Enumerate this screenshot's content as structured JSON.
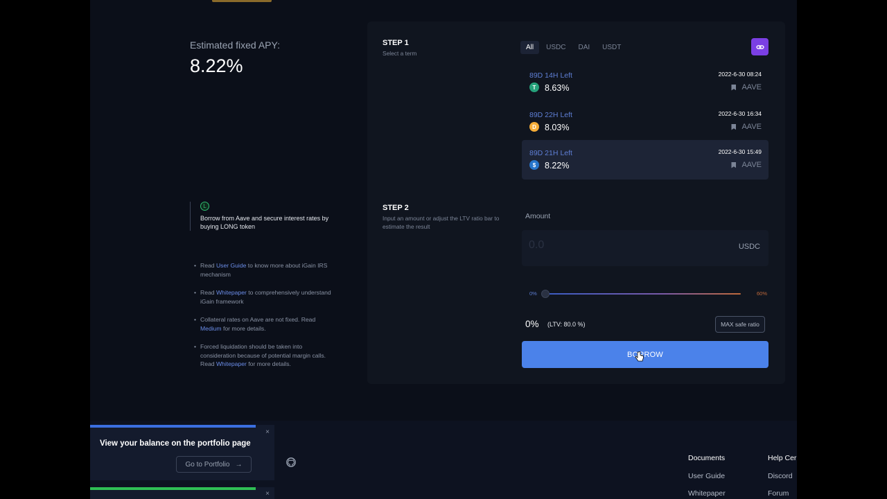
{
  "apy": {
    "label": "Estimated fixed APY:",
    "value": "8.22%"
  },
  "info": {
    "icon_text": "L",
    "description": "Borrow from Aave and secure interest rates by buying LONG token"
  },
  "notes": [
    {
      "pre": "Read ",
      "link": "User Guide",
      "post": " to know more about iGain IRS mechanism"
    },
    {
      "pre": "Read ",
      "link": "Whitepaper",
      "post": " to comprehensively understand iGain framework"
    },
    {
      "pre": "Collateral rates on Aave are not fixed. Read ",
      "link": "Medium",
      "post": " for more details."
    },
    {
      "pre": "Forced liquidation should be taken into consideration because of potential margin calls. Read ",
      "link": "Whitepaper",
      "post": " for more details."
    }
  ],
  "step1": {
    "title": "STEP 1",
    "subtitle": "Select a term"
  },
  "step2": {
    "title": "STEP 2",
    "subtitle": "Input an amount or adjust the LTV ratio bar to estimate the result"
  },
  "tabs": [
    "All",
    "USDC",
    "DAI",
    "USDT"
  ],
  "terms": [
    {
      "duration": "89D 14H",
      "left": "Left",
      "coin": "T",
      "coin_color": "#26a17b",
      "rate": "8.63%",
      "date": "2022-6-30 08:24",
      "protocol": "AAVE"
    },
    {
      "duration": "89D 22H",
      "left": "Left",
      "coin": "D",
      "coin_color": "#f5ac37",
      "rate": "8.03%",
      "date": "2022-6-30 16:34",
      "protocol": "AAVE"
    },
    {
      "duration": "89D 21H",
      "left": "Left",
      "coin": "$",
      "coin_color": "#2775ca",
      "rate": "8.22%",
      "date": "2022-6-30 15:49",
      "protocol": "AAVE"
    }
  ],
  "amount": {
    "label": "Amount",
    "placeholder": "0.0",
    "unit": "USDC"
  },
  "slider": {
    "min_label": "0%",
    "max_label": "60%",
    "value": 0
  },
  "ltv": {
    "percent": "0%",
    "text": "(LTV: 80.0 %)",
    "max_button": "MAX safe ratio"
  },
  "borrow_button": "BORROW",
  "footer": {
    "col1": {
      "head": "Documents",
      "links": [
        "User Guide",
        "Whitepaper"
      ]
    },
    "col2": {
      "head": "Help Cer",
      "links": [
        "Discord",
        "Forum"
      ]
    }
  },
  "toast": {
    "message": "View your balance on the portfolio page",
    "button": "Go to Portfolio",
    "arrow": "→",
    "close": "×"
  },
  "colors": {
    "accent": "#4b82ea",
    "background": "#0b0f19",
    "panel": "#10151f",
    "link_button": "#7b3fe4"
  }
}
